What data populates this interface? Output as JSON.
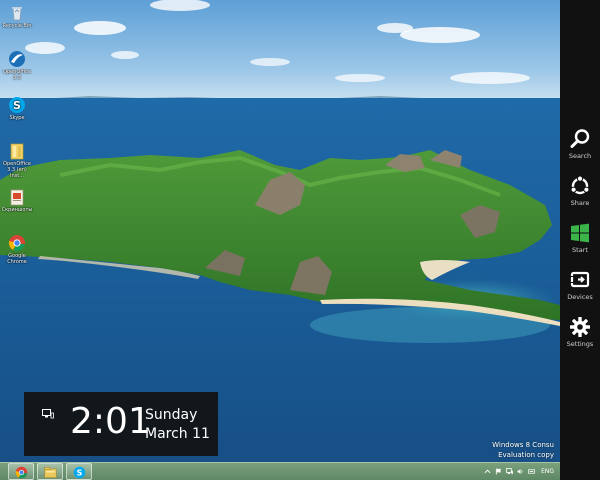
{
  "desktop": {
    "icons": [
      {
        "label": "Recycle Bin",
        "icon": "recycle-bin-icon"
      },
      {
        "label": "OpenOffice\n3.3",
        "icon": "openoffice-icon"
      },
      {
        "label": "Skype",
        "icon": "skype-icon"
      },
      {
        "label": "OpenOffice\n3.3 (en) Inst...",
        "icon": "openoffice-installer-icon"
      },
      {
        "label": "Скриншоты",
        "icon": "folder-icon"
      },
      {
        "label": "Google\nChrome",
        "icon": "chrome-icon"
      }
    ]
  },
  "clock": {
    "time": "2:01",
    "day": "Sunday",
    "date": "March 11",
    "status_icon": "network-icon"
  },
  "watermark": {
    "line1": "Windows 8 Consu",
    "line2": "Evaluation copy"
  },
  "taskbar": {
    "pinned": [
      {
        "icon": "chrome-icon"
      },
      {
        "icon": "file-explorer-icon"
      },
      {
        "icon": "skype-icon"
      }
    ],
    "tray": {
      "icons": [
        "chevron-up-icon",
        "flag-icon",
        "network-icon",
        "volume-icon",
        "keyboard-icon"
      ],
      "language": "ENG"
    }
  },
  "charms": [
    {
      "label": "Search",
      "icon": "search-icon"
    },
    {
      "label": "Share",
      "icon": "share-icon"
    },
    {
      "label": "Start",
      "icon": "windows-logo-icon",
      "accent": "#3bb449"
    },
    {
      "label": "Devices",
      "icon": "devices-icon"
    },
    {
      "label": "Settings",
      "icon": "gear-icon"
    }
  ],
  "colors": {
    "charms_bar": "#111111",
    "start_accent": "#3bb449",
    "taskbar": "#6f9a72"
  }
}
